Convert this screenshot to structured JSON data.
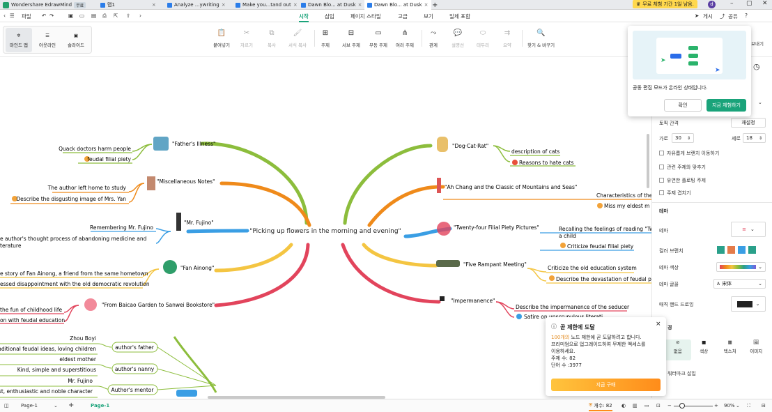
{
  "titlebar": {
    "app_name": "Wondershare EdrawMind",
    "app_badge": "무료",
    "tabs": [
      {
        "label": "맵1"
      },
      {
        "label": "Analyze ...ywriting"
      },
      {
        "label": "Make you...tand out"
      },
      {
        "label": "Dawn Blo... at Dusk"
      },
      {
        "label": "Dawn Blo... at Dusk"
      }
    ],
    "new_tab": "+",
    "trial_text": "무료 체험 기간 1일 남음.",
    "user_initial": "d"
  },
  "menubar": {
    "file": "파일",
    "items": [
      "시작",
      "삽입",
      "페이지 스타일",
      "고급",
      "보기",
      "일체 포함"
    ],
    "share_post": "게시",
    "share": "공유"
  },
  "toolbar": {
    "views": [
      "마인드 맵",
      "아웃라인",
      "슬라이드"
    ],
    "buttons": [
      "붙여넣기",
      "자르기",
      "복사",
      "서식 복사",
      "주제",
      "서브 주제",
      "부동 주제",
      "여러 주제",
      "관계",
      "설명선",
      "테두리",
      "요약",
      "찾기 & 바꾸기"
    ],
    "partial_right": "보내기"
  },
  "mindmap": {
    "central": "\"Picking up flowers in the morning and evening\"",
    "left": [
      {
        "topic": "\"Father's Illness\"",
        "subs": [
          "Quack doctors harm people",
          "feudal filial piety"
        ],
        "color": "#8cbd3c"
      },
      {
        "topic": "\"Miscellaneous Notes\"",
        "subs": [
          "The author left home to study",
          "Describe the disgusting image of Mrs. Yan"
        ],
        "color": "#ef8a1a"
      },
      {
        "topic": "\"Mr. Fujino\"",
        "subs": [
          "Remembering Mr. Fujino",
          "e author's thought process of abandoning medicine and",
          "terature"
        ],
        "color": "#3a9ee4"
      },
      {
        "topic": "\"Fan Ainong\"",
        "subs": [
          "e story of Fan Ainong, a friend from the same hometown",
          "essed disappointment with the old democratic revolution"
        ],
        "color": "#f4c542"
      },
      {
        "topic": "\"From Baicao Garden to Sanwei Bookstore\"",
        "subs": [
          "the fun of childhood life",
          "on with feudal education"
        ],
        "color": "#e2445c"
      }
    ],
    "right": [
      {
        "topic": "\"Dog·Cat·Rat\"",
        "subs": [
          "description of cats",
          "Reasons to hate cats"
        ],
        "color": "#8cbd3c"
      },
      {
        "topic": "\"Ah Chang and the Classic of Mountains and Seas\"",
        "subs": [
          "Characteristics of the",
          "Miss my eldest m"
        ],
        "color": "#ef8a1a"
      },
      {
        "topic": "\"Twenty-four Filial Piety Pictures\"",
        "subs": [
          "Recalling the feelings of reading \"Tw",
          "a child",
          "Criticize feudal filial piety"
        ],
        "color": "#3a9ee4"
      },
      {
        "topic": "\"Five Rampant Meeting\"",
        "subs": [
          "Criticize the old education system",
          "Describe the devastation of feudal pa"
        ],
        "color": "#f4c542"
      },
      {
        "topic": "\"Impermanence\"",
        "subs": [
          "Describe the impermanence of the seducer",
          "Satire on unscrupulous literati"
        ],
        "color": "#e2445c"
      }
    ],
    "characters": [
      {
        "name": "Zhou Boyi",
        "trait": "traditional feudal ideas, loving children",
        "role": "author's father"
      },
      {
        "name": "eldest mother",
        "trait": "Kind, simple and superstitious",
        "role": "author's nanny"
      },
      {
        "name": "Mr. Fujino",
        "trait": "nest, enthusiastic and noble character",
        "role": "Author's mentor"
      }
    ]
  },
  "right_panel": {
    "topic_spacing": "토픽 간격",
    "reset": "재설정",
    "horizontal": "가로",
    "h_value": "30",
    "vertical": "세로",
    "v_value": "18",
    "options": [
      "자유롭게 브랜치 이동하기",
      "관련 주제와 맞추기",
      "유연한 플로팅 주제",
      "주제 겹치기"
    ],
    "theme_heading": "테마",
    "theme_label": "테마",
    "color_branch": "컬러 브랜치",
    "theme_color": "테마 색상",
    "theme_font": "테마 글꼴",
    "font_value": "宋体",
    "hand_drawn": "매직 핸드 드로잉",
    "bg_partial": "경",
    "bg_tabs": [
      "없음",
      "색상",
      "텍스처",
      "이미지"
    ],
    "watermark": "워터마크 삽입"
  },
  "collab_popup": {
    "message": "공동 편집 모드가 온라인 상태입니다.",
    "confirm": "확인",
    "try_now": "지금 체험하기"
  },
  "limit_notice": {
    "title": "곧 제한에 도달",
    "highlight": "100개의",
    "body1": " 노드 제한에 곧 도달하려고 합니다.",
    "body2": "프리미엄으로 업그레이드하여 무제한 액세스를",
    "body3": "이용하세요.",
    "topics": "주제 수: 82",
    "words": "단어 수 :3977",
    "buy": "지금 구매",
    "close": "×"
  },
  "statusbar": {
    "page_dropdown": "Page-1",
    "page_tab": "Page-1",
    "count": "개수: 82",
    "zoom": "90%"
  }
}
